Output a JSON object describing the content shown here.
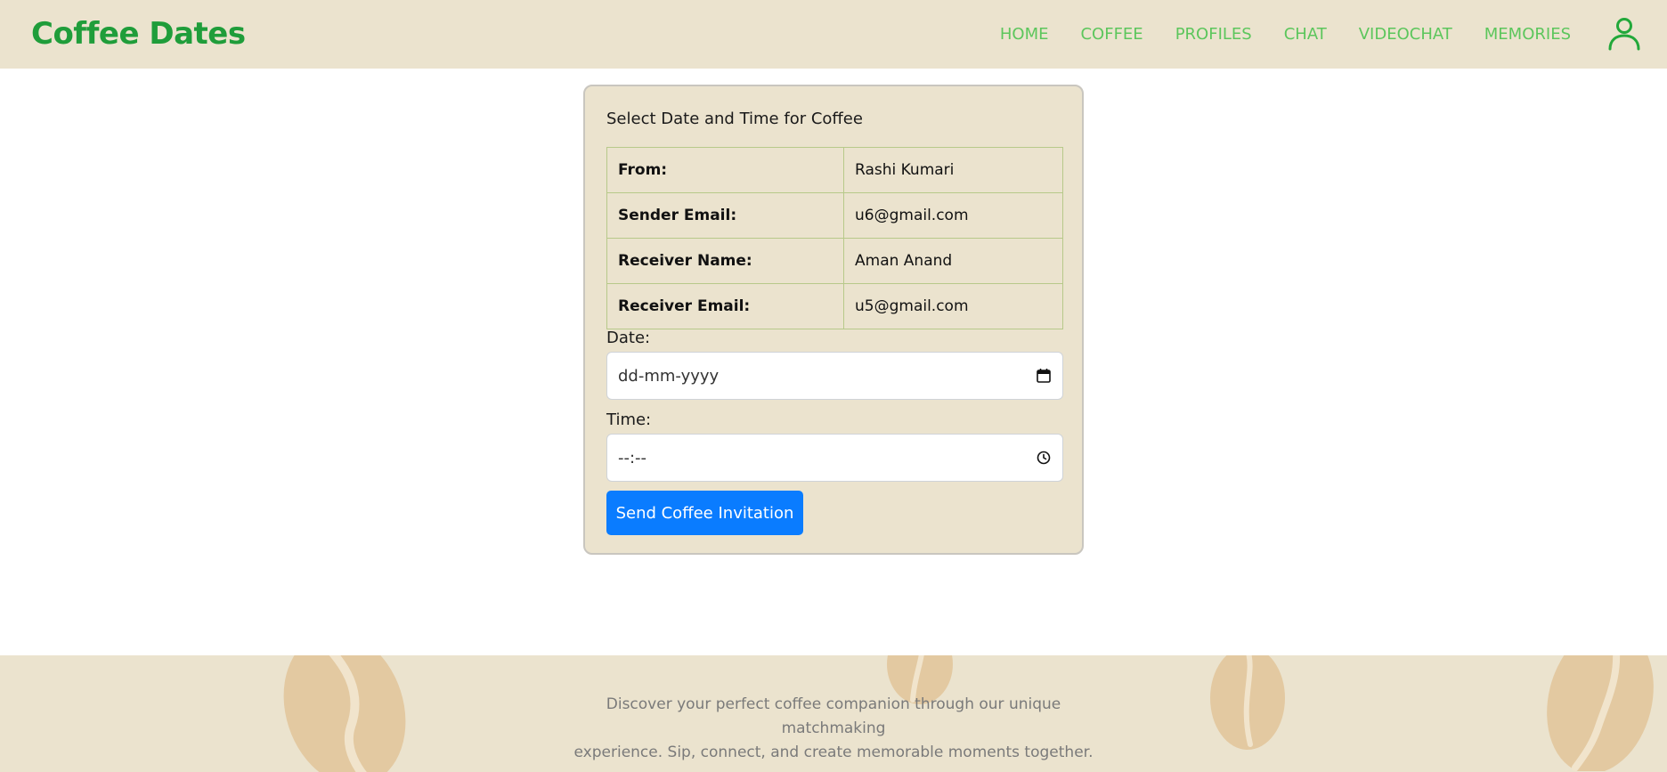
{
  "header": {
    "brand": "Coffee Dates",
    "nav": [
      "HOME",
      "COFFEE",
      "PROFILES",
      "CHAT",
      "VIDEOCHAT",
      "MEMORIES"
    ],
    "user_icon": "user-icon"
  },
  "form": {
    "title": "Select Date and Time for Coffee",
    "rows": [
      {
        "label": "From:",
        "value": "Rashi Kumari"
      },
      {
        "label": "Sender Email:",
        "value": "u6@gmail.com"
      },
      {
        "label": "Receiver Name:",
        "value": "Aman Anand"
      },
      {
        "label": "Receiver Email:",
        "value": "u5@gmail.com"
      }
    ],
    "date_label": "Date:",
    "date_placeholder": "dd-mm-yyyy",
    "time_label": "Time:",
    "time_placeholder": "--:--",
    "submit_label": "Send Coffee Invitation"
  },
  "footer": {
    "text_line1": "Discover your perfect coffee companion through our unique matchmaking",
    "text_line2": "experience. Sip, connect, and create memorable moments together."
  },
  "colors": {
    "brand": "#1f9d3a",
    "nav": "#5cc65c",
    "panel": "#ebe3ce",
    "button": "#0a7cff",
    "bean": "#e3c9a1"
  }
}
